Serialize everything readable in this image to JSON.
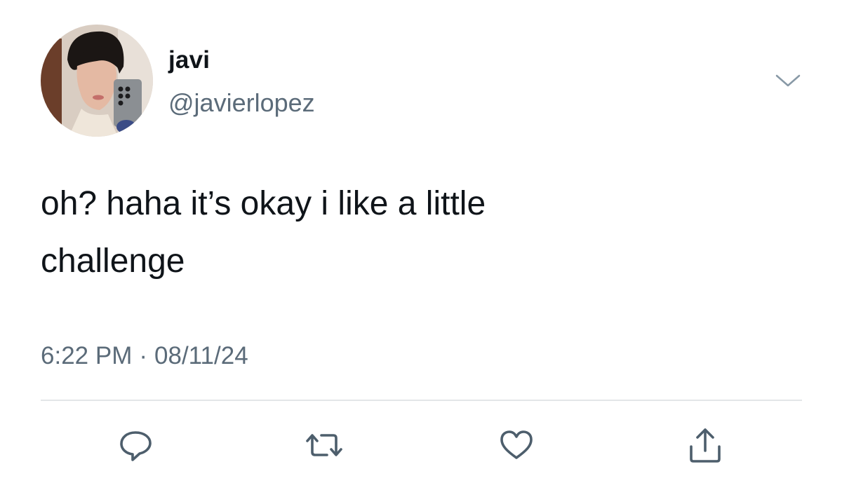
{
  "user": {
    "display_name": "javi",
    "handle": "@javierlopez"
  },
  "tweet": {
    "text_line1": "oh? haha it’s okay i like a little",
    "text_line2": "challenge"
  },
  "meta": {
    "time": "6:22 PM",
    "separator": "·",
    "date": "08/11/24"
  },
  "actions": [
    "reply-icon",
    "retweet-icon",
    "like-icon",
    "share-icon"
  ],
  "colors": {
    "text": "#0f1419",
    "secondary": "#5b6b79",
    "divider": "#e3e6e8"
  }
}
